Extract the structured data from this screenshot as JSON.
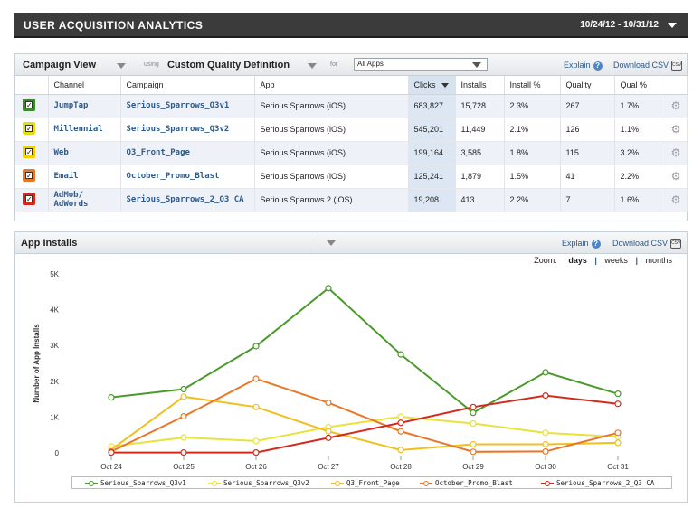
{
  "header": {
    "title": "USER ACQUISITION ANALYTICS",
    "date_range": "10/24/12 - 10/31/12"
  },
  "campaign_panel": {
    "view_label": "Campaign View",
    "using_label": "using",
    "definition_label": "Custom Quality Definition",
    "for_label": "for",
    "app_filter": "All Apps",
    "explain_label": "Explain",
    "download_label": "Download CSV",
    "columns": [
      "Channel",
      "Campaign",
      "App",
      "Clicks",
      "Installs",
      "Install %",
      "Quality",
      "Qual %"
    ],
    "rows": [
      {
        "color": "#3a8a2a",
        "channel": "JumpTap",
        "campaign": "Serious_Sparrows_Q3v1",
        "app": "Serious Sparrows (iOS)",
        "clicks": "683,827",
        "installs": "15,728",
        "install_pct": "2.3%",
        "quality": "267",
        "qual_pct": "1.7%"
      },
      {
        "color": "#e8dc1a",
        "channel": "Millennial",
        "campaign": "Serious_Sparrows_Q3v2",
        "app": "Serious Sparrows (iOS)",
        "clicks": "545,201",
        "installs": "11,449",
        "install_pct": "2.1%",
        "quality": "126",
        "qual_pct": "1.1%"
      },
      {
        "color": "#f2d100",
        "channel": "Web",
        "campaign": "Q3_Front_Page",
        "app": "Serious Sparrows (iOS)",
        "clicks": "199,164",
        "installs": "3,585",
        "install_pct": "1.8%",
        "quality": "115",
        "qual_pct": "3.2%"
      },
      {
        "color": "#e8772a",
        "channel": "Email",
        "campaign": "October_Promo_Blast",
        "app": "Serious Sparrows (iOS)",
        "clicks": "125,241",
        "installs": "1,879",
        "install_pct": "1.5%",
        "quality": "41",
        "qual_pct": "2.2%"
      },
      {
        "color": "#d42a1e",
        "channel": "AdMob/\nAdWords",
        "campaign": "Serious_Sparrows_2_Q3 CA",
        "app": "Serious Sparrows 2 (iOS)",
        "clicks": "19,208",
        "installs": "413",
        "install_pct": "2.2%",
        "quality": "7",
        "qual_pct": "1.6%"
      }
    ]
  },
  "installs_panel": {
    "title": "App Installs",
    "explain_label": "Explain",
    "download_label": "Download CSV",
    "zoom_label": "Zoom:",
    "zoom_options": [
      "days",
      "weeks",
      "months"
    ],
    "zoom_selected": "days"
  },
  "chart_data": {
    "type": "line",
    "title": "",
    "xlabel": "",
    "ylabel": "Number of App Installs",
    "x": [
      "Oct 24",
      "Oct 25",
      "Oct 26",
      "Oct 27",
      "Oct 28",
      "Oct 29",
      "Oct 30",
      "Oct 31"
    ],
    "yticks": [
      "0",
      "1K",
      "2K",
      "3K",
      "4K",
      "5K"
    ],
    "ylim": [
      0,
      5000
    ],
    "grid": false,
    "legend": "bottom",
    "series": [
      {
        "name": "Serious_Sparrows_Q3v1",
        "color": "#4a9a2a",
        "values": [
          1550,
          1780,
          2980,
          4600,
          2750,
          1120,
          2250,
          1650
        ]
      },
      {
        "name": "Serious_Sparrows_Q3v2",
        "color": "#e9e23a",
        "values": [
          180,
          430,
          330,
          720,
          1010,
          820,
          560,
          450
        ]
      },
      {
        "name": "Q3_Front_Page",
        "color": "#f0c020",
        "values": [
          90,
          1570,
          1280,
          600,
          80,
          240,
          240,
          280
        ]
      },
      {
        "name": "October_Promo_Blast",
        "color": "#e8772a",
        "values": [
          40,
          1020,
          2070,
          1400,
          600,
          30,
          40,
          560
        ]
      },
      {
        "name": "Serious_Sparrows_2_Q3 CA",
        "color": "#d42a1e",
        "values": [
          10,
          10,
          10,
          420,
          840,
          1280,
          1600,
          1370
        ]
      }
    ]
  }
}
